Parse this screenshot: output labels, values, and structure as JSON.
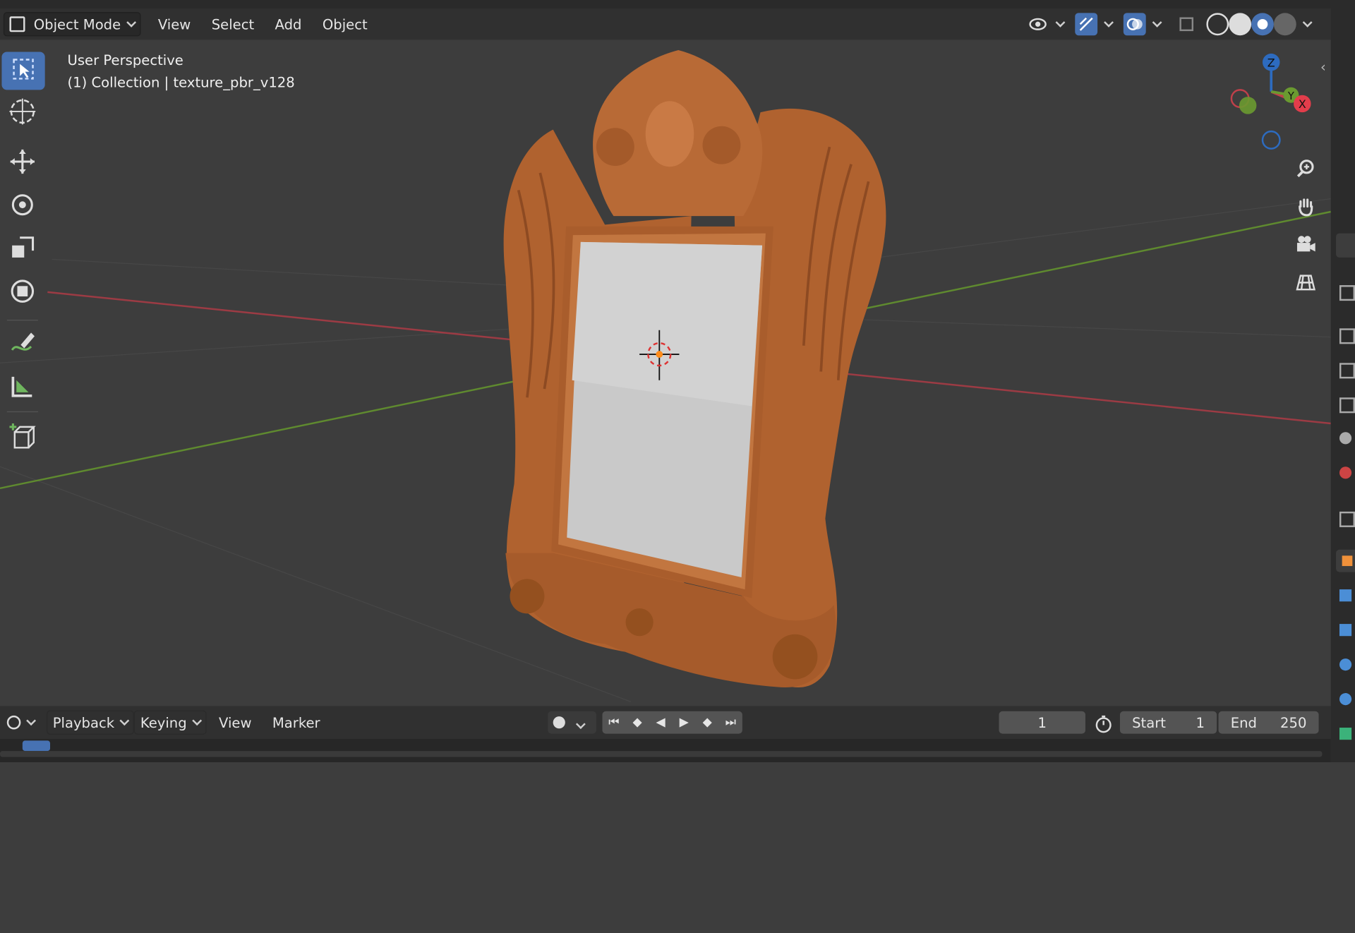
{
  "header": {
    "mode_label": "Object Mode",
    "menus": [
      "View",
      "Select",
      "Add",
      "Object"
    ]
  },
  "viewport": {
    "perspective_label": "User Perspective",
    "collection_label": "(1) Collection | texture_pbr_v128",
    "gizmo": {
      "x": "X",
      "y": "Y",
      "z": "Z"
    },
    "colors": {
      "x_axis": "#c0404a",
      "y_axis": "#6a9a30",
      "z_axis": "#2d6bbf",
      "frame_wood": "#b8693a",
      "accent": "#4772b3"
    }
  },
  "timeline": {
    "editor_icon": "clock-icon",
    "menus": [
      "Playback",
      "Keying",
      "View",
      "Marker"
    ],
    "current_frame": "1",
    "start_label": "Start",
    "start_value": "1",
    "end_label": "End",
    "end_value": "250"
  },
  "toolbar": {
    "tools": [
      "select-box-icon",
      "cursor-icon",
      "move-icon",
      "rotate-icon",
      "scale-icon",
      "transform-icon",
      "annotate-icon",
      "measure-icon",
      "add-cube-icon"
    ]
  }
}
